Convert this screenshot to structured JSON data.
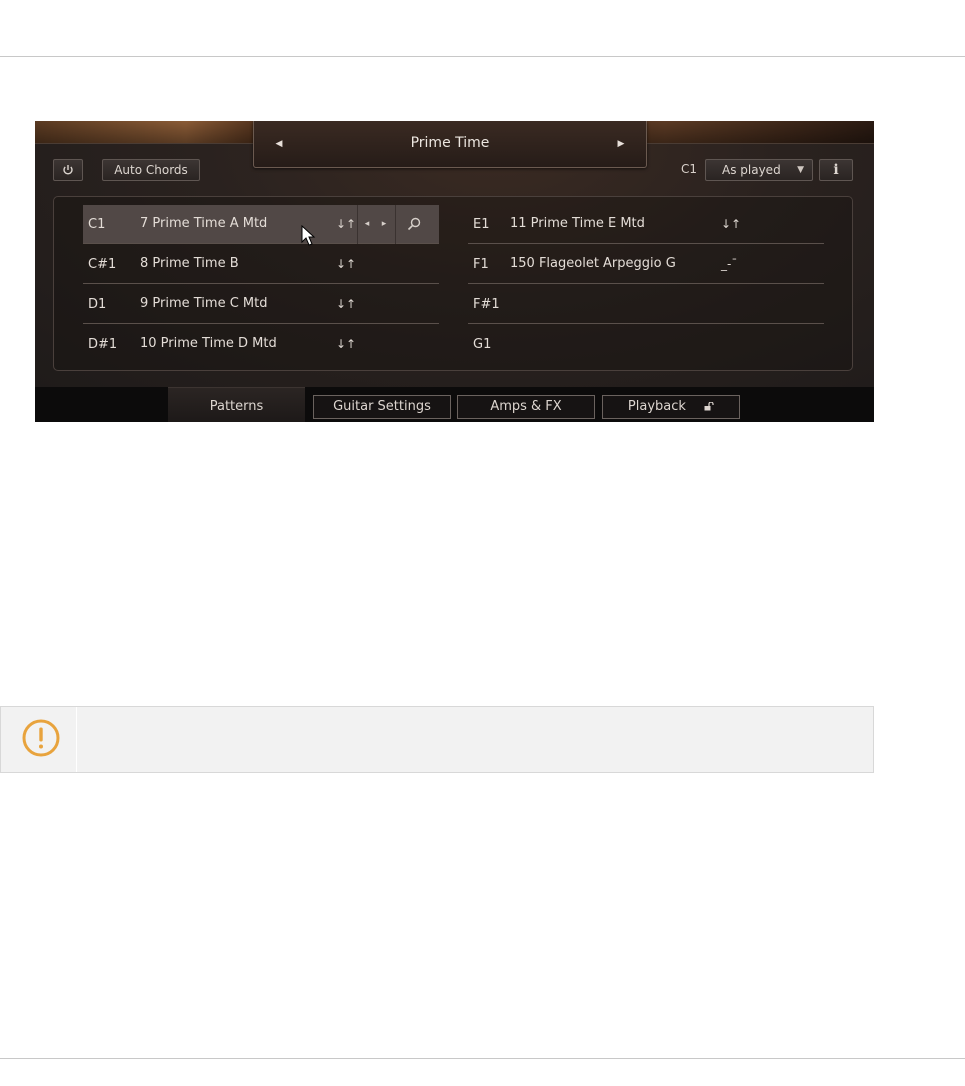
{
  "plugin": {
    "preset": {
      "title": "Prime Time",
      "prev_icon": "triangle-left",
      "next_icon": "triangle-right"
    },
    "toolbar": {
      "power_icon": "power-icon",
      "auto_chords_label": "Auto Chords",
      "root_key": "C1",
      "playback_mode": "As played",
      "info_label": "i"
    },
    "patterns": {
      "left": [
        {
          "key": "C1",
          "name": "7  Prime Time A Mtd",
          "symbol": "↓↑",
          "selected": true
        },
        {
          "key": "C#1",
          "name": "8  Prime Time B",
          "symbol": "↓↑"
        },
        {
          "key": "D1",
          "name": "9  Prime Time C Mtd",
          "symbol": "↓↑"
        },
        {
          "key": "D#1",
          "name": "10  Prime Time D Mtd",
          "symbol": "↓↑"
        }
      ],
      "right": [
        {
          "key": "E1",
          "name": "11  Prime Time E Mtd",
          "symbol": "↓↑"
        },
        {
          "key": "F1",
          "name": "150  Flageolet Arpeggio G",
          "symbol": "_-ˉ"
        },
        {
          "key": "F#1",
          "name": "",
          "symbol": ""
        },
        {
          "key": "G1",
          "name": "",
          "symbol": ""
        }
      ],
      "row_tools": {
        "prev": "◂",
        "next": "▸",
        "search_icon": "magnifier-icon"
      }
    },
    "tabs": [
      {
        "label": "Patterns",
        "active": true
      },
      {
        "label": "Guitar Settings"
      },
      {
        "label": "Amps & FX"
      },
      {
        "label": "Playback"
      }
    ]
  },
  "notice": {
    "icon": "warning-circle-icon",
    "accent_color": "#e8a33d"
  },
  "colors": {
    "panel_bg": "#1b1716",
    "text": "#e4ddd7",
    "selected_row": "#514846"
  }
}
